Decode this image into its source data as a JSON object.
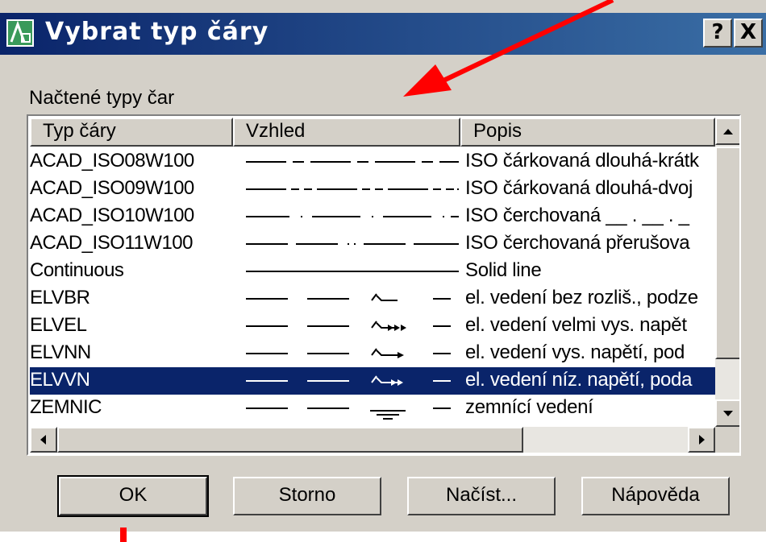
{
  "dialog": {
    "title": "Vybrat typ čáry",
    "help_button": "?",
    "close_button": "X",
    "section_label": "Načtené typy čar"
  },
  "columns": [
    "Typ čáry",
    "Vzhled",
    "Popis"
  ],
  "linetypes": [
    {
      "name": "ACAD_ISO08W100",
      "description": "ISO čárkovaná dlouhá-krátk",
      "pattern": "long-short-dash"
    },
    {
      "name": "ACAD_ISO09W100",
      "description": "ISO čárkovaná dlouhá-dvoj",
      "pattern": "long-double-short-dash"
    },
    {
      "name": "ACAD_ISO10W100",
      "description": "ISO čerchovaná __ . __ . _",
      "pattern": "dash-dot"
    },
    {
      "name": "ACAD_ISO11W100",
      "description": "ISO čerchovaná přerušova",
      "pattern": "double-dash-dot"
    },
    {
      "name": "Continuous",
      "description": "Solid line",
      "pattern": "continuous"
    },
    {
      "name": "ELVBR",
      "description": "el. vedení bez rozliš., podze",
      "pattern": "electric-plain"
    },
    {
      "name": "ELVEL",
      "description": "el. vedení velmi vys. napět",
      "pattern": "electric-very-high"
    },
    {
      "name": "ELVNN",
      "description": "el. vedení vys. napětí, pod",
      "pattern": "electric-high"
    },
    {
      "name": "ELVVN",
      "description": "el. vedení níz. napětí, poda",
      "pattern": "electric-low",
      "selected": true
    },
    {
      "name": "ZEMNIC",
      "description": "zemnící vedení",
      "pattern": "ground"
    }
  ],
  "buttons": {
    "ok": "OK",
    "cancel": "Storno",
    "load": "Načíst...",
    "help": "Nápověda"
  },
  "colors": {
    "title_bar": "#0a246a",
    "selection": "#0a246a",
    "annotation_arrow": "#ff0000"
  }
}
